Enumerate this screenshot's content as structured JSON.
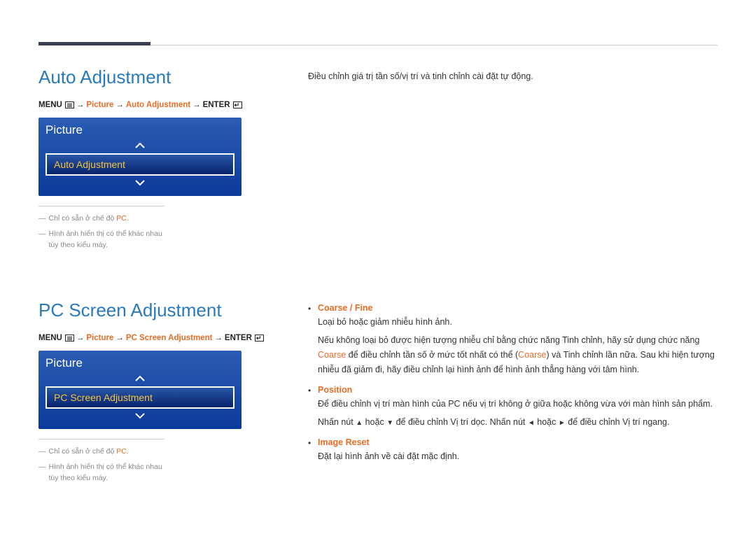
{
  "section1": {
    "title": "Auto Adjustment",
    "breadcrumb": {
      "menu": "MENU",
      "p1": "Picture",
      "p2": "Auto Adjustment",
      "enter": "ENTER"
    },
    "osd": {
      "title": "Picture",
      "selected": "Auto Adjustment"
    },
    "footnotes": {
      "f1a": "Chỉ có sẵn ở chế độ ",
      "f1b": "PC",
      "f1c": ".",
      "f2": "Hình ảnh hiển thị có thể khác nhau tùy theo kiểu máy."
    },
    "right_desc": "Điều chỉnh giá trị tần số/vị trí và tinh chỉnh cài đặt tự động."
  },
  "section2": {
    "title": "PC Screen Adjustment",
    "breadcrumb": {
      "menu": "MENU",
      "p1": "Picture",
      "p2": "PC Screen Adjustment",
      "enter": "ENTER"
    },
    "osd": {
      "title": "Picture",
      "selected": "PC Screen Adjustment"
    },
    "footnotes": {
      "f1a": "Chỉ có sẵn ở chế độ ",
      "f1b": "PC",
      "f1c": ".",
      "f2": "Hình ảnh hiển thị có thể khác nhau tùy theo kiểu máy."
    },
    "bullets": {
      "b1": {
        "h1": "Coarse",
        "sep": " / ",
        "h2": "Fine",
        "p1": "Loại bỏ hoặc giảm nhiễu hình ảnh.",
        "p2a": "Nếu không loại bỏ được hiện tượng nhiễu chỉ bằng chức năng Tinh chỉnh, hãy sử dụng chức năng ",
        "p2b": "Coarse",
        "p2c": " để điều chỉnh tần số ở mức tốt nhất có thể (",
        "p2d": "Coarse",
        "p2e": ") và Tinh chỉnh lần nữa. Sau khi hiện tượng nhiễu đã giảm đi, hãy điều chỉnh lại hình ảnh để hình ảnh thẳng hàng với tâm hình."
      },
      "b2": {
        "h": "Position",
        "p1": "Để điều chỉnh vị trí màn hình của PC nếu vị trí không ở giữa hoặc không vừa với màn hình sản phẩm.",
        "p2a": "Nhấn nút ",
        "p2b": " hoặc ",
        "p2c": " để điều chỉnh Vị trí dọc. Nhấn nút ",
        "p2d": " hoặc ",
        "p2e": " để điều chỉnh Vị trí ngang."
      },
      "b3": {
        "h": "Image Reset",
        "p": "Đặt lại hình ảnh về cài đặt mặc định."
      }
    }
  },
  "arrows": {
    "arrow": "→",
    "dash": "―"
  },
  "tri": {
    "up": "▲",
    "down": "▼",
    "left": "◄",
    "right": "►"
  }
}
